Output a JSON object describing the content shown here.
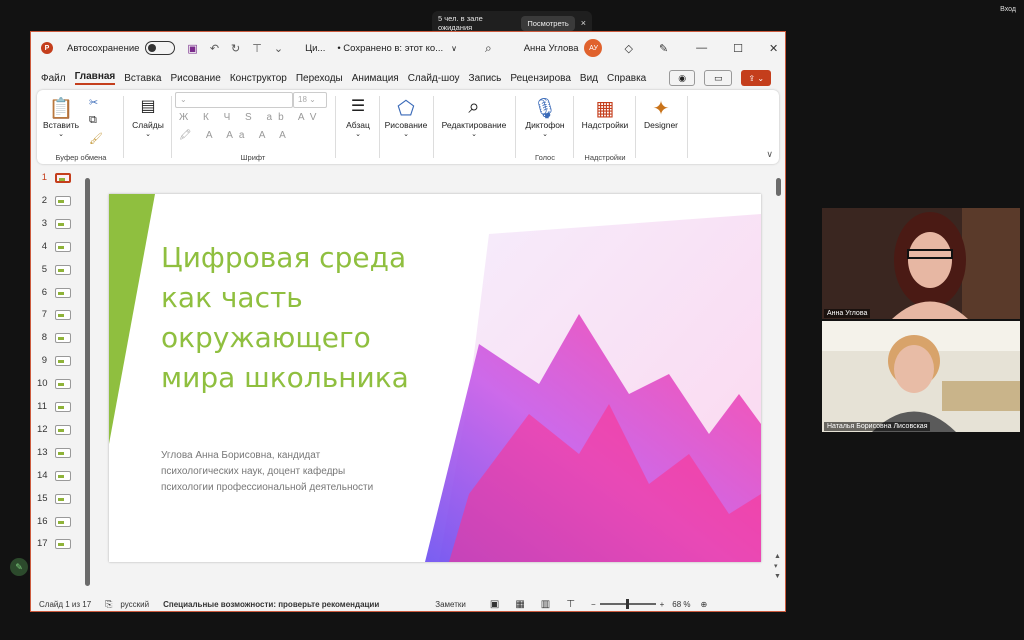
{
  "zoom_bar": {
    "waiting_text": "5 чел. в зале ожидания",
    "view_button": "Посмотреть",
    "close_glyph": "×",
    "login": "Вход"
  },
  "titlebar": {
    "autosave_label": "Автосохранение",
    "doc_name": "Ци...",
    "saved_status": "• Сохранено в: этот ко...",
    "user_name": "Анна Углова",
    "user_initials": "АУ"
  },
  "menu": {
    "tabs": [
      "Файл",
      "Главная",
      "Вставка",
      "Рисование",
      "Конструктор",
      "Переходы",
      "Анимация",
      "Слайд-шоу",
      "Запись",
      "Рецензирова",
      "Вид",
      "Справка"
    ],
    "active_tab": "Главная"
  },
  "ribbon": {
    "paste_label": "Вставить",
    "clipboard_group": "Буфер обмена",
    "slides_label": "Слайды",
    "font_size": "18",
    "font_group": "Шрифт",
    "paragraph_label": "Абзац",
    "drawing_label": "Рисование",
    "editing_label": "Редактирование",
    "dictate_label": "Диктофон",
    "voice_group": "Голос",
    "addins_label": "Надстройки",
    "addins_group": "Надстройки",
    "designer_label": "Designer"
  },
  "thumbnails": [
    "1",
    "2",
    "3",
    "4",
    "5",
    "6",
    "7",
    "8",
    "9",
    "10",
    "11",
    "12",
    "13",
    "14",
    "15",
    "16",
    "17"
  ],
  "slide": {
    "title_lines": [
      "Цифровая среда",
      "как часть",
      "окружающего",
      "мира школьника"
    ],
    "subtitle_lines": [
      "Углова Анна Борисовна, кандидат",
      "психологических наук, доцент кафедры",
      "психологии профессиональной деятельности"
    ],
    "accent_color": "#8fbf3f"
  },
  "status_bar": {
    "slide_count": "Слайд 1 из 17",
    "language": "русский",
    "accessibility": "Специальные возможности: проверьте рекомендации",
    "notes": "Заметки",
    "zoom": "68 %"
  },
  "participants": [
    {
      "name": "Анна Углова"
    },
    {
      "name": "Наталья Борисовна Лисовская"
    }
  ]
}
